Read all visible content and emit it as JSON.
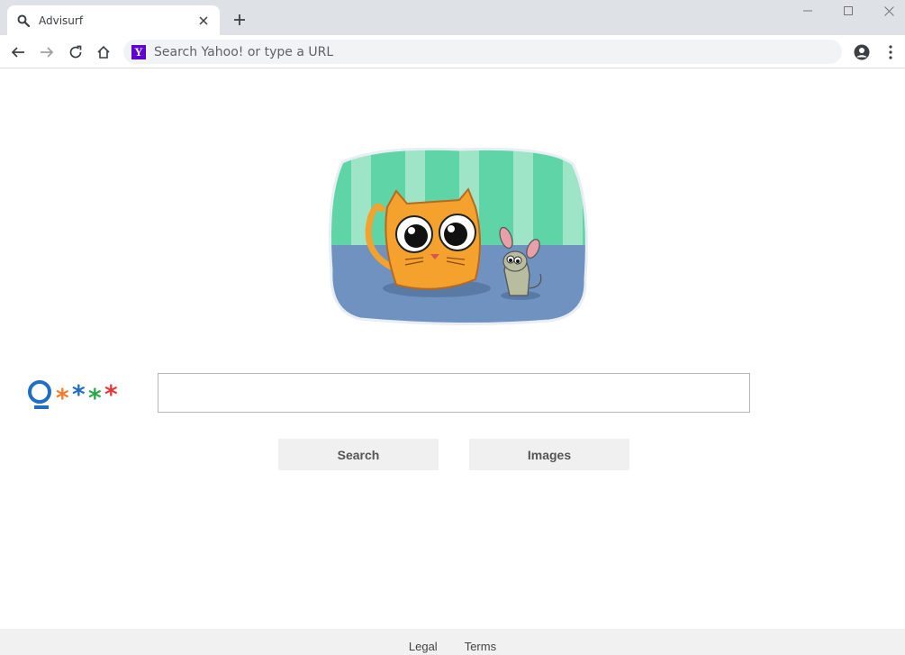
{
  "tab": {
    "title": "Advisurf"
  },
  "omnibox": {
    "placeholder": "Search Yahoo! or type a URL",
    "engine_logo_letter": "Y"
  },
  "search": {
    "value": "",
    "search_button": "Search",
    "images_button": "Images"
  },
  "footer": {
    "links": [
      "Legal",
      "Terms"
    ]
  },
  "colors": {
    "tabstrip": "#dee1e6",
    "omnibox": "#f1f3f4",
    "yahoo": "#5f01d1",
    "button": "#f0f0f0",
    "footer": "#f1f1f1"
  }
}
